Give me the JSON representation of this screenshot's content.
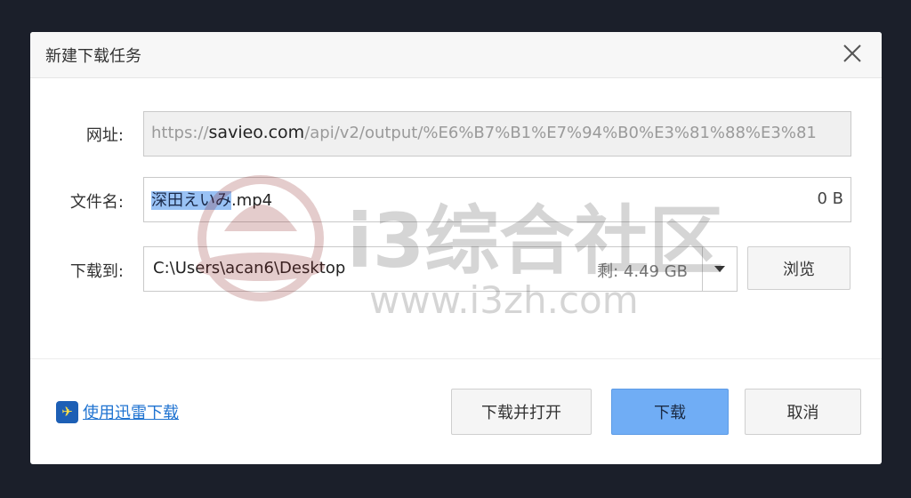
{
  "dialog": {
    "title": "新建下载任务",
    "close_icon": "close-icon"
  },
  "url": {
    "label": "网址:",
    "prefix": "https://",
    "domain": "savieo.com",
    "path": "/api/v2/output/%E6%B7%B1%E7%94%B0%E3%81%88%E3%81"
  },
  "filename": {
    "label": "文件名:",
    "selected_part": "深田えいみ",
    "ext": ".mp4",
    "size": "0 B"
  },
  "save_to": {
    "label": "下载到:",
    "path": "C:\\Users\\acan6\\Desktop",
    "free_space": "剩: 4.49 GB",
    "dropdown_icon": "caret-down-icon",
    "browse_label": "浏览"
  },
  "footer": {
    "thunder_label": "使用迅雷下载",
    "thunder_icon": "thunder-icon",
    "open_label": "下载并打开",
    "download_label": "下载",
    "cancel_label": "取消"
  },
  "watermark": {
    "line1": "i3综合社区",
    "line2": "www.i3zh.com"
  },
  "colors": {
    "primary_button": "#70adf5",
    "link": "#1f73d1",
    "selection": "#99c2f5"
  }
}
